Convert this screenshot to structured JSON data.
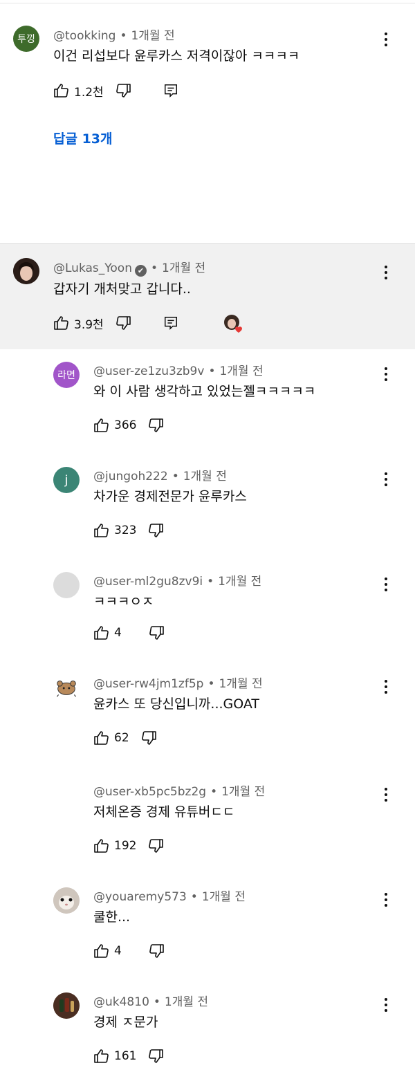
{
  "comments": [
    {
      "avatar_text": "투낑",
      "avatar_color": "#3e6b2b",
      "handle": "@tookking",
      "time": "1개월 전",
      "text": "이건 리섭보다 윤루카스 저격이잖아 ㅋㅋㅋㅋ",
      "likes": "1.2천",
      "replies_label": "답글 13개"
    },
    {
      "avatar_text": "",
      "avatar_color": "#5a3a2e",
      "handle": "@Lukas_Yoon",
      "verified_icon": "✔",
      "time": "1개월 전",
      "text": "갑자기 개처맞고 갑니다..",
      "likes": "3.9천"
    }
  ],
  "replies": [
    {
      "avatar_text": "라면",
      "avatar_color": "#a155c9",
      "handle": "@user-ze1zu3zb9v",
      "time": "1개월 전",
      "text": "와 이 사람 생각하고 있었는젤ㅋㅋㅋㅋㅋ",
      "likes": "366"
    },
    {
      "avatar_text": "j",
      "avatar_color": "#3b8575",
      "handle": "@jungoh222",
      "time": "1개월 전",
      "text": "차가운 경제전문가 윤루카스",
      "likes": "323"
    },
    {
      "avatar_text": "",
      "avatar_color": "#dcdcdc",
      "handle": "@user-ml2gu8zv9i",
      "time": "1개월 전",
      "text": "ㅋㅋㅋㅇㅈ",
      "likes": "4"
    },
    {
      "avatar_text": "",
      "avatar_color": "#ffffff",
      "handle": "@user-rw4jm1zf5p",
      "time": "1개월 전",
      "text": "윤카스 또 당신입니까...GOAT",
      "likes": "62"
    },
    {
      "avatar_text": "",
      "avatar_color": "#ffffff",
      "handle": "@user-xb5pc5bz2g",
      "time": "1개월 전",
      "text": "저체온증 경제 유튜버ㄷㄷ",
      "likes": "192"
    },
    {
      "avatar_text": "",
      "avatar_color": "#c9c0b8",
      "handle": "@youaremy573",
      "time": "1개월 전",
      "text": "쿨한...",
      "likes": "4"
    },
    {
      "avatar_text": "",
      "avatar_color": "#6b4a3a",
      "handle": "@uk4810",
      "time": "1개월 전",
      "text": "경제 ㅈ문가",
      "likes": "161"
    }
  ]
}
